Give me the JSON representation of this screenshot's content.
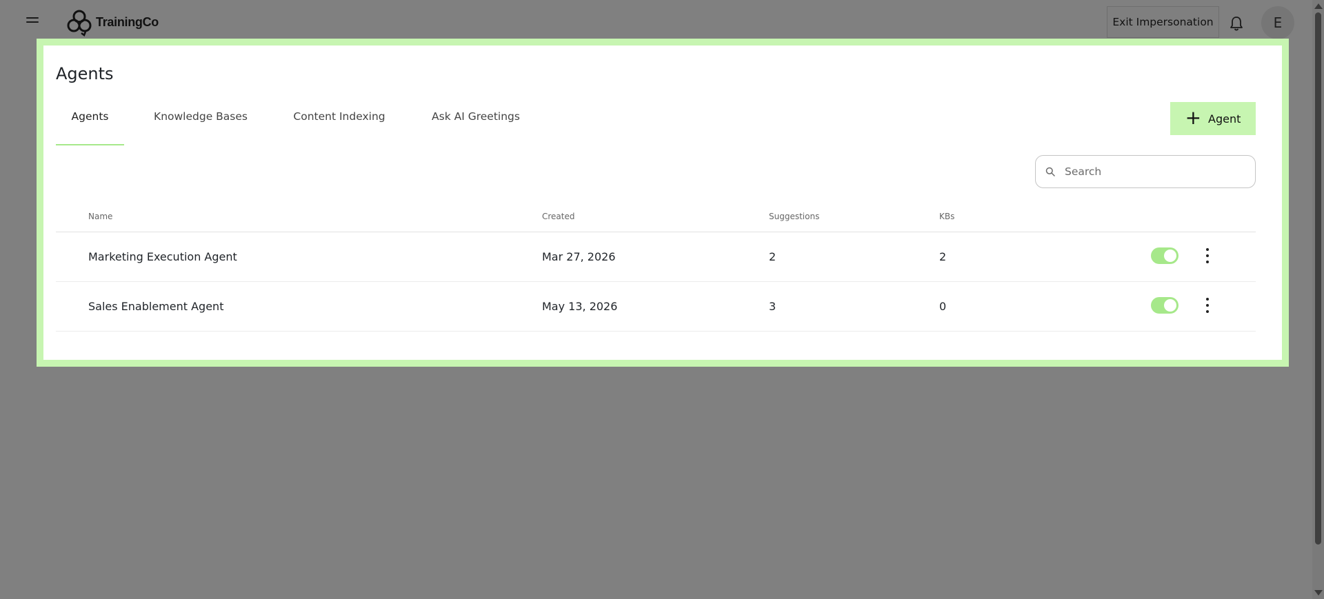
{
  "header": {
    "logo_text": "TrainingCo",
    "exit_label": "Exit Impersonation",
    "avatar_initial": "E"
  },
  "page": {
    "title": "Agents",
    "tabs": [
      {
        "label": "Agents",
        "active": true
      },
      {
        "label": "Knowledge Bases",
        "active": false
      },
      {
        "label": "Content Indexing",
        "active": false
      },
      {
        "label": "Ask AI Greetings",
        "active": false
      }
    ],
    "add_button_label": "Agent",
    "search_placeholder": "Search"
  },
  "table": {
    "columns": [
      "Name",
      "Created",
      "Suggestions",
      "KBs"
    ],
    "rows": [
      {
        "name": "Marketing Execution Agent",
        "created": "Mar 27, 2026",
        "suggestions": "2",
        "kbs": "2",
        "enabled": true
      },
      {
        "name": "Sales Enablement Agent",
        "created": "May 13, 2026",
        "suggestions": "3",
        "kbs": "0",
        "enabled": true
      }
    ]
  },
  "colors": {
    "accent": "#c7f5b1",
    "toggle_on": "#a6e88a",
    "overlay": "#808080"
  },
  "icons": [
    "menu-icon",
    "logo-icon",
    "bell-icon",
    "search-icon",
    "plus-icon",
    "kebab-menu-icon"
  ]
}
